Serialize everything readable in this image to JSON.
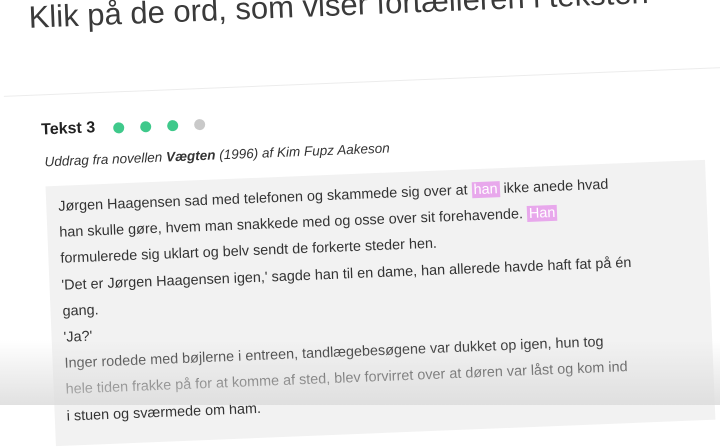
{
  "page": {
    "title": "Klik på de ord, som viser fortælleren i teksten"
  },
  "exercise": {
    "label": "Tekst 3",
    "progress": {
      "completed": 3,
      "total": 4
    },
    "source_prefix": "Uddrag fra novellen ",
    "source_title": "Vægten",
    "source_suffix": " (1996) af Kim Fupz Aakeson"
  },
  "text": {
    "line1_a": "Jørgen Haagensen sad med telefonen og skammede sig over at ",
    "line1_hl": "han",
    "line1_b": " ikke anede hvad",
    "line2_a": "han skulle gøre, hvem man snakkede med og osse over sit forehavende. ",
    "line2_hl": "Han",
    "line3": "formulerede sig uklart og belv sendt de forkerte steder hen.",
    "line4": "'Det er Jørgen Haagensen igen,' sagde han til en dame, han allerede havde haft fat på én",
    "line5": "gang.",
    "line6": "'Ja?'",
    "line7": "Inger rodede med bøjlerne i entreen, tandlægebesøgene var dukket op igen, hun tog",
    "line8": "hele tiden frakke på for at komme af sted, blev forvirret over at døren var låst og kom ind",
    "line9": "i stuen og sværmede om ham."
  },
  "colors": {
    "progress_done": "#3fc98b",
    "progress_todo": "#c9c9c9",
    "highlight": "#e8a8ec"
  }
}
